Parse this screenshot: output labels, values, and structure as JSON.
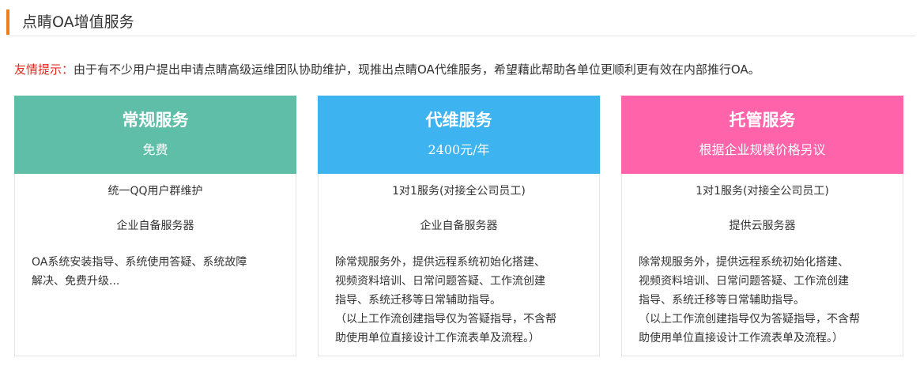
{
  "header": {
    "title": "点睛OA增值服务"
  },
  "notice": {
    "label": "友情提示：",
    "text": "由于有不少用户提出申请点睛高级运维团队协助维护，现推出点睛OA代维服务，希望藉此帮助各单位更顺利更有效在内部推行OA。"
  },
  "colors": {
    "accent": "#f07d1a",
    "notice_label": "#e02a20",
    "regular": "#5fbea8",
    "maintenance": "#3db3ef",
    "hosting": "#ff63aa"
  },
  "cards": [
    {
      "title": "常规服务",
      "price": "免费",
      "feature1": "统一QQ用户群维护",
      "feature2": "企业自备服务器",
      "desc": [
        "OA系统安装指导、系统使用答疑、系统故障",
        "解决、免费升级..."
      ]
    },
    {
      "title": "代维服务",
      "price": "2400元/年",
      "feature1": "1对1服务(对接全公司员工)",
      "feature2": "企业自备服务器",
      "desc": [
        "除常规服务外，提供远程系统初始化搭建、",
        "视频资料培训、日常问题答疑、工作流创建",
        "指导、系统迁移等日常辅助指导。",
        "（以上工作流创建指导仅为答疑指导，不含帮",
        "助使用单位直接设计工作流表单及流程。）"
      ]
    },
    {
      "title": "托管服务",
      "price": "根据企业规模价格另议",
      "feature1": "1对1服务(对接全公司员工)",
      "feature2": "提供云服务器",
      "desc": [
        "除常规服务外，提供远程系统初始化搭建、",
        "视频资料培训、日常问题答疑、工作流创建",
        "指导、系统迁移等日常辅助指导。",
        "（以上工作流创建指导仅为答疑指导，不含帮",
        "助使用单位直接设计工作流表单及流程。）"
      ]
    }
  ]
}
